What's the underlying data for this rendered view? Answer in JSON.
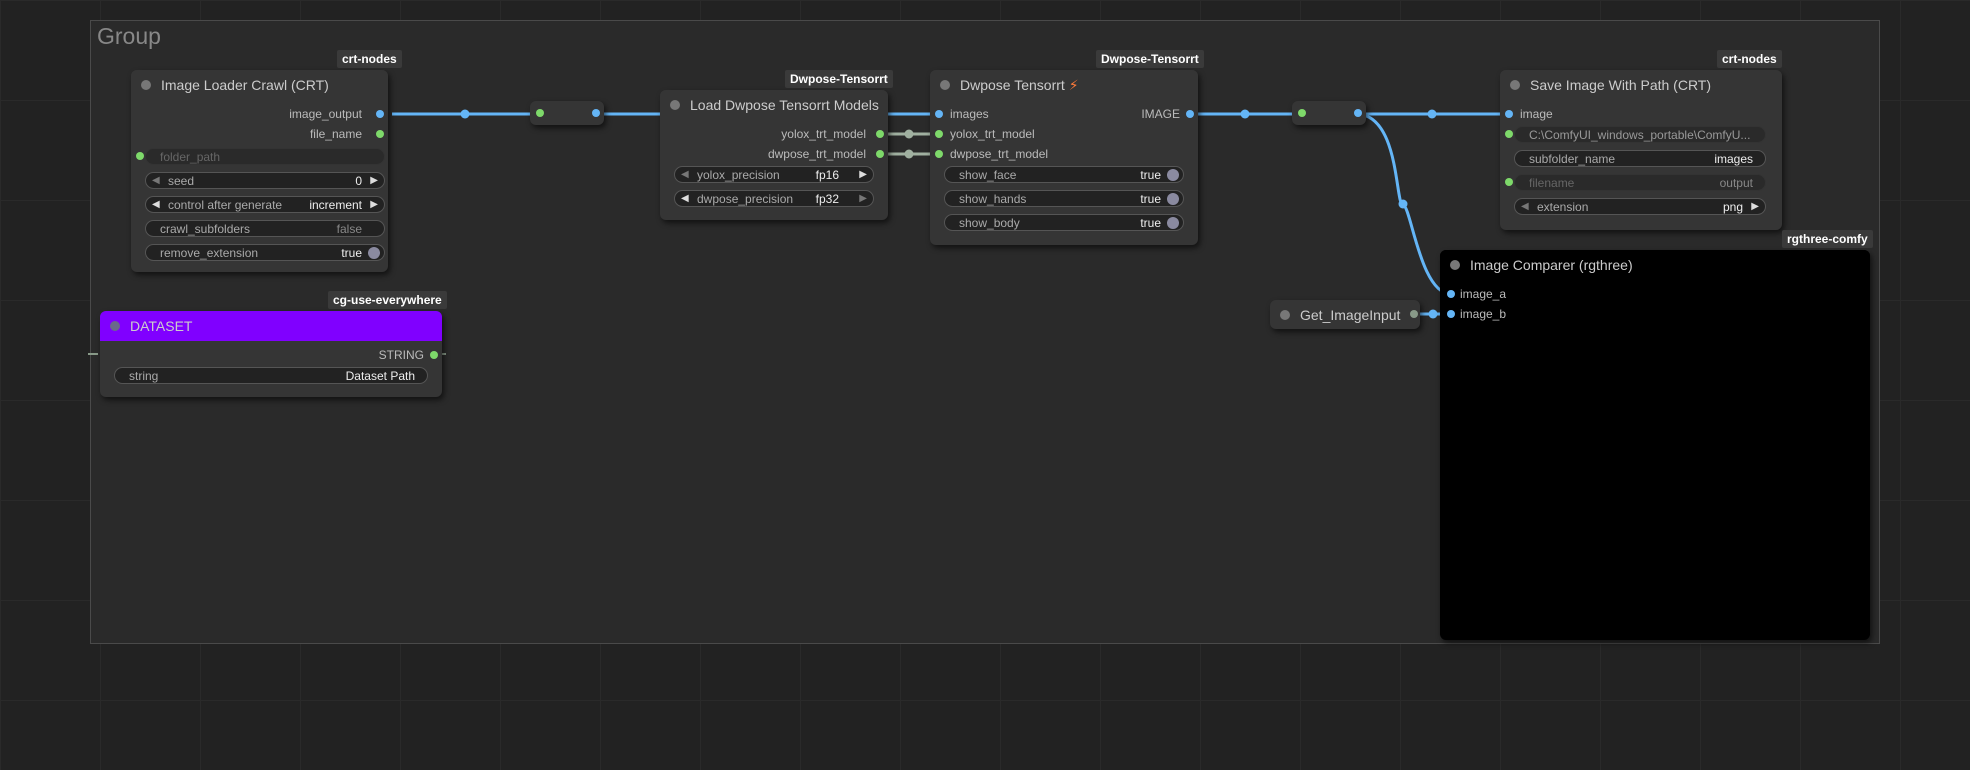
{
  "group": {
    "title": "Group"
  },
  "badges": {
    "loader": "crt-nodes",
    "load_models": "Dwpose-Tensorrt",
    "dwpose": "Dwpose-Tensorrt",
    "save": "crt-nodes",
    "comparer": "rgthree-comfy",
    "dataset": "cg-use-everywhere"
  },
  "loader": {
    "title": "Image Loader Crawl (CRT)",
    "outputs": [
      "image_output",
      "file_name"
    ],
    "folder_path": "folder_path",
    "seed": {
      "name": "seed",
      "value": "0"
    },
    "control": {
      "name": "control after generate",
      "value": "increment"
    },
    "crawl": {
      "name": "crawl_subfolders",
      "value": "false"
    },
    "remove": {
      "name": "remove_extension",
      "value": "true"
    }
  },
  "load_models": {
    "title": "Load Dwpose Tensorrt Models",
    "outputs": [
      "yolox_trt_model",
      "dwpose_trt_model"
    ],
    "yolox_precision": {
      "name": "yolox_precision",
      "value": "fp16"
    },
    "dwpose_precision": {
      "name": "dwpose_precision",
      "value": "fp32"
    }
  },
  "dwpose": {
    "title": "Dwpose Tensorrt",
    "title_icon": "⚡",
    "inputs": [
      "images",
      "yolox_trt_model",
      "dwpose_trt_model"
    ],
    "output": "IMAGE",
    "show_face": {
      "name": "show_face",
      "value": "true"
    },
    "show_hands": {
      "name": "show_hands",
      "value": "true"
    },
    "show_body": {
      "name": "show_body",
      "value": "true"
    }
  },
  "save": {
    "title": "Save Image With Path (CRT)",
    "input": "image",
    "path_value": "C:\\ComfyUI_windows_portable\\ComfyU...",
    "subfolder": {
      "name": "subfolder_name",
      "value": "images"
    },
    "filename": {
      "name": "filename",
      "value": "output"
    },
    "extension": {
      "name": "extension",
      "value": "png"
    }
  },
  "comparer": {
    "title": "Image Comparer (rgthree)",
    "inputs": [
      "image_a",
      "image_b"
    ]
  },
  "get_image": {
    "title": "Get_ImageInput"
  },
  "dataset": {
    "title": "DATASET",
    "output": "STRING",
    "string": {
      "name": "string",
      "value": "Dataset Path"
    },
    "header_color": "#8000ff"
  },
  "colors": {
    "image_link": "#64b5f6",
    "model_link": "#a0b0a0",
    "node_bg": "#353535"
  }
}
